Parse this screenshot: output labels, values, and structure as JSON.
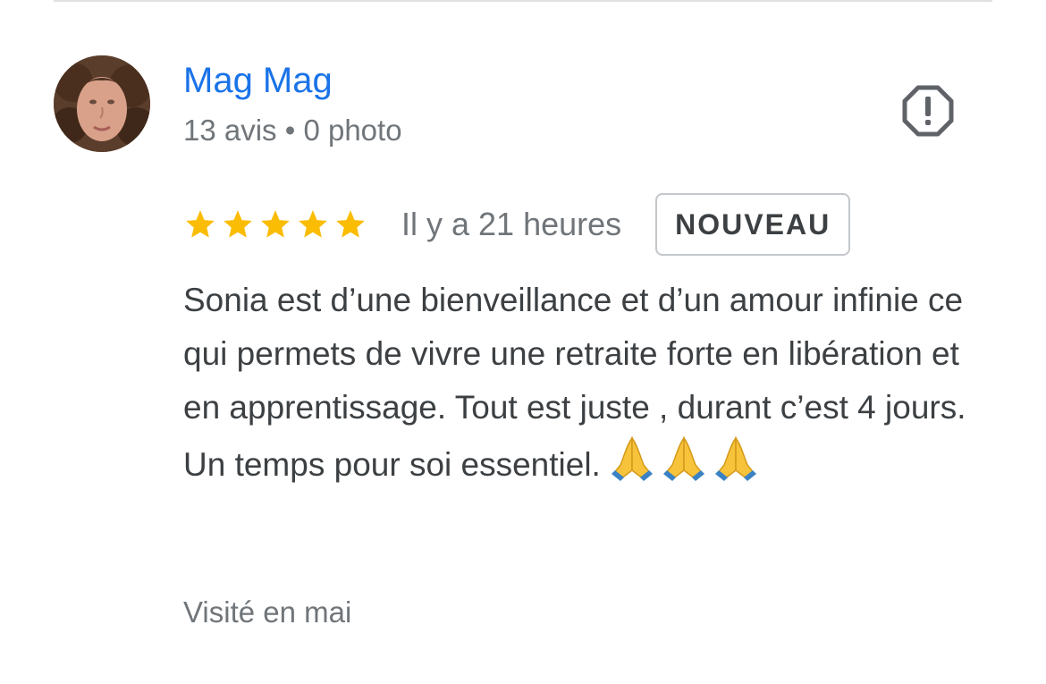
{
  "reviewer": {
    "name": "Mag Mag",
    "meta": "13 avis • 0 photo"
  },
  "review": {
    "rating": 5,
    "max_rating": 5,
    "time_ago": "Il y a 21 heures",
    "badge": "NOUVEAU",
    "text": "Sonia est d’une bienveillance et d’un amour infinie ce qui permets de vivre une retraite forte en libération et en apprentissage. Tout est juste , durant c’est 4 jours. Un temps pour soi essentiel.",
    "emojis": [
      "folded-hands-icon",
      "folded-hands-icon",
      "folded-hands-icon"
    ],
    "visit_note": "Visité en mai"
  },
  "colors": {
    "name_link": "#1a73e8",
    "star": "#fbbc04",
    "secondary_text": "#70757a",
    "body_text": "#3c4043",
    "badge_border": "#c4c7cb"
  },
  "icons": {
    "report": "report-flag-icon"
  }
}
